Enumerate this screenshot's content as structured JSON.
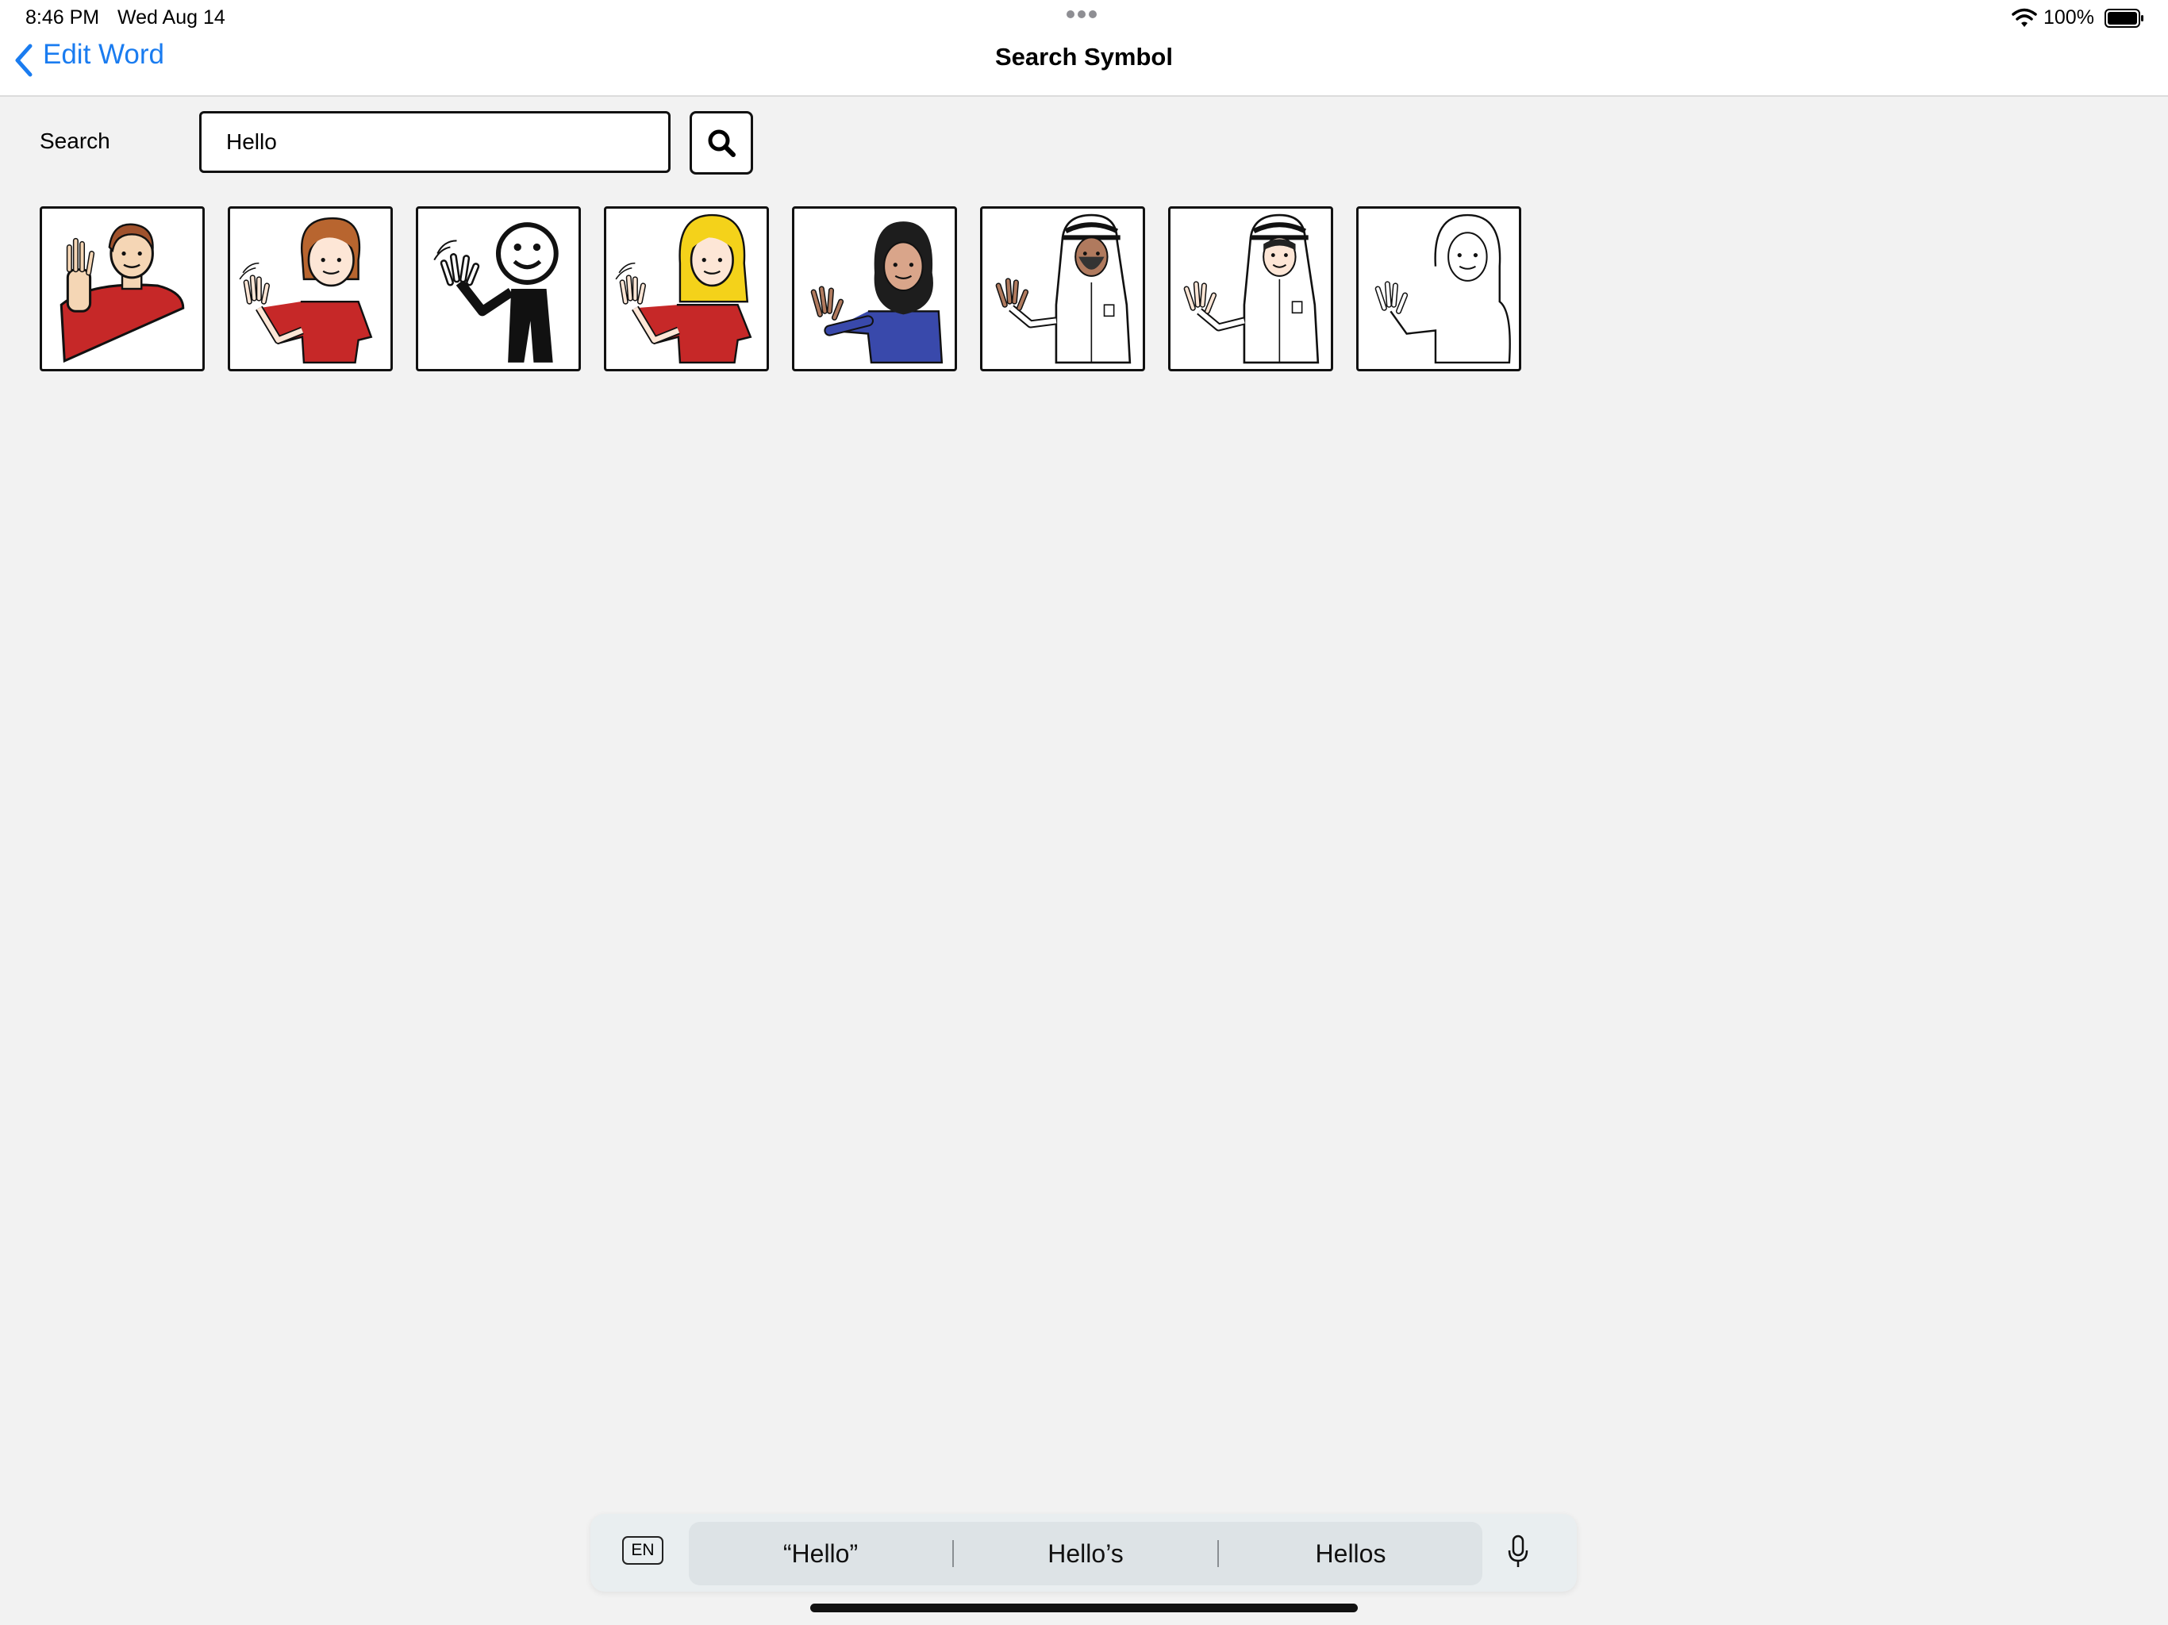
{
  "status": {
    "time": "8:46 PM",
    "date": "Wed Aug 14",
    "battery": "100%"
  },
  "nav": {
    "back_label": "Edit Word",
    "title": "Search Symbol"
  },
  "search": {
    "label": "Search",
    "value": "Hello"
  },
  "symbols": [
    "man-waving-red-shirt",
    "girl-waving-red-shirt",
    "stick-figure-waving",
    "blonde-girl-waving",
    "woman-in-hijab-waving",
    "man-in-ghutra-waving",
    "boy-in-ghutra-waving",
    "outline-person-waving"
  ],
  "keyboard": {
    "lang": "EN",
    "suggestions": [
      "“Hello”",
      "Hello’s",
      "Hellos"
    ]
  },
  "colors": {
    "accent": "#1a7cf0",
    "shirt_red": "#b71c1c",
    "hijab_blue": "#3949ab"
  }
}
